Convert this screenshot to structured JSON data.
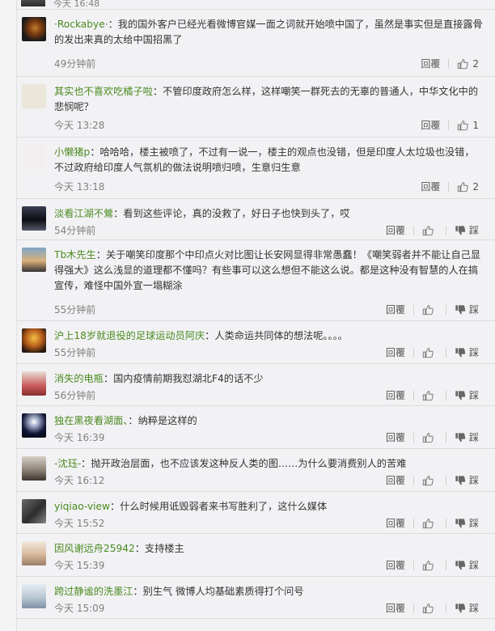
{
  "top_partial": {
    "time": "今天 16:48"
  },
  "actions": {
    "reply": "回覆",
    "tread": "踩"
  },
  "comments": [
    {
      "username": "·Rockabye·",
      "lines": [
        "：我的国外客户已经光看微博官媒一面之词就开始喷中国了，虽然是事实但是直接露骨",
        "的发出来真的太给中国招黑了"
      ],
      "time": "49分钟前",
      "likes": "2"
    },
    {
      "username": "其实也不喜欢吃橘子啦",
      "lines": [
        "：不管印度政府怎么样，这样嘲笑一群死去的无辜的普通人，中华文化中的",
        "悲悯呢？"
      ],
      "time": "今天 13:28",
      "likes": "1"
    },
    {
      "username": "小懒猪p",
      "lines": [
        "：哈哈哈，楼主被喷了，不过有一说一，楼主的观点也没错，但是印度人太垃圾也没错，",
        "不过政府给印度人气氛机的做法说明喷归喷，生意归生意"
      ],
      "time": "今天 13:18",
      "likes": "2"
    },
    {
      "username": "淡看江湖不鶯",
      "lines": [
        "：看到这些评论，真的没救了，好日子也快到头了，哎"
      ],
      "time": "54分钟前",
      "likes": ""
    },
    {
      "username": "Tb木先生",
      "lines": [
        "：关于嘲笑印度那个中印点火对比图让长安网显得非常愚蠢！《嘲笑弱者并不能让自己显",
        "得强大》这么浅显的道理都不懂吗？有些事可以这么想但不能这么说。都是这种没有智慧的人在搞",
        "宣传，难怪中国外宣一塌糊涂"
      ],
      "time": "55分钟前",
      "likes": ""
    },
    {
      "username": "沪上18岁就退役的足球运动员阿庆",
      "lines": [
        "：人类命运共同体的想法呢。。。。"
      ],
      "time": "55分钟前",
      "likes": ""
    },
    {
      "username": "消失的电瓶",
      "lines": [
        "：国内疫情前期我怼湖北F4的话不少"
      ],
      "time": "56分钟前",
      "likes": ""
    },
    {
      "username": "独在黑夜看湖面、",
      "lines": [
        "：纳粹是这样的"
      ],
      "time": "今天 16:39",
      "likes": ""
    },
    {
      "username": "-沈珏-",
      "lines": [
        "：抛开政治层面，也不应该发这种反人类的图……为什么要消费别人的苦难"
      ],
      "time": "今天 16:12",
      "likes": ""
    },
    {
      "username": "yiqiao-view",
      "lines": [
        "：什么时候用诋毁弱者来书写胜利了，这什么媒体"
      ],
      "time": "今天 15:52",
      "likes": ""
    },
    {
      "username": "因风谢远舟25942",
      "lines": [
        "：支持楼主"
      ],
      "time": "今天 15:39",
      "likes": ""
    },
    {
      "username": "跨过静谧的洗墨江",
      "lines": [
        "：别生气 微博人均基础素质得打个问号"
      ],
      "time": "今天 15:09",
      "likes": ""
    }
  ]
}
